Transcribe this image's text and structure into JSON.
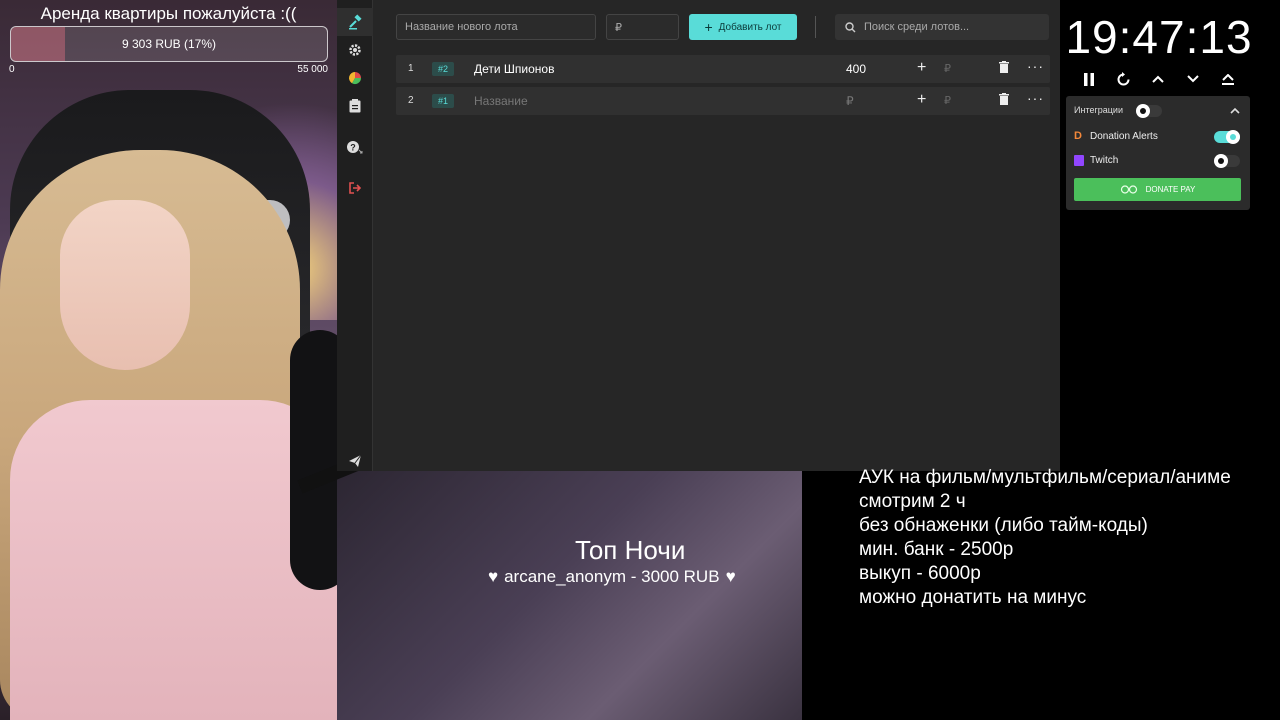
{
  "goal": {
    "title": "Аренда квартиры пожалуйста :((",
    "progress_text": "9 303 RUB (17%)",
    "progress_fraction": 0.17,
    "min": "0",
    "max": "55 000"
  },
  "toolbar": {
    "new_lot_placeholder": "Название нового лота",
    "currency_placeholder": "₽",
    "add_label": "Добавить лот",
    "search_placeholder": "Поиск среди лотов..."
  },
  "lots": [
    {
      "num": "1",
      "tag": "#2",
      "name": "Дети Шпионов",
      "amount": "400",
      "rub": "₽"
    },
    {
      "num": "2",
      "tag": "#1",
      "name": "Название",
      "amount": "₽",
      "rub": "₽"
    }
  ],
  "timer": {
    "clock": "19:47:13"
  },
  "integrations": {
    "title": "Интеграции",
    "items": [
      {
        "label": "Donation Alerts",
        "enabled": true
      },
      {
        "label": "Twitch",
        "enabled": false
      }
    ],
    "donate_label": "DONATE PAY"
  },
  "overlay": {
    "top_night": "Топ Ночи",
    "top_donor": "arcane_anonym - 3000 RUB"
  },
  "rules": [
    "АУК на фильм/мультфильм/сериал/аниме",
    "смотрим 2 ч",
    "без обнаженки (либо тайм-коды)",
    "мин. банк - 2500р",
    "выкуп - 6000р",
    "можно донатить на минус"
  ],
  "colors": {
    "accent": "#59dcd8",
    "donate": "#4bbf5b",
    "logout": "#e05050"
  }
}
